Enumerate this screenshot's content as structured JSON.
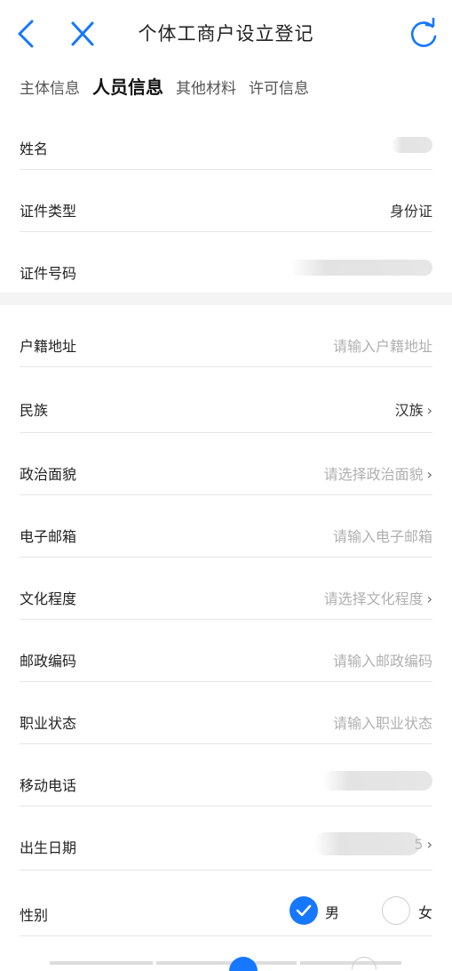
{
  "header": {
    "title": "个体工商户设立登记"
  },
  "tabs": [
    {
      "label": "主体信息"
    },
    {
      "label": "人员信息"
    },
    {
      "label": "其他材料"
    },
    {
      "label": "许可信息"
    }
  ],
  "fields": {
    "name": {
      "label": "姓名"
    },
    "id_type": {
      "label": "证件类型",
      "value": "身份证"
    },
    "id_number": {
      "label": "证件号码"
    },
    "household": {
      "label": "户籍地址",
      "placeholder": "请输入户籍地址"
    },
    "ethnicity": {
      "label": "民族",
      "value": "汉族"
    },
    "political": {
      "label": "政治面貌",
      "placeholder": "请选择政治面貌"
    },
    "email": {
      "label": "电子邮箱",
      "placeholder": "请输入电子邮箱"
    },
    "education": {
      "label": "文化程度",
      "placeholder": "请选择文化程度"
    },
    "postcode": {
      "label": "邮政编码",
      "placeholder": "请输入邮政编码"
    },
    "occupation": {
      "label": "职业状态",
      "placeholder": "请输入职业状态"
    },
    "mobile": {
      "label": "移动电话"
    },
    "birthday": {
      "label": "出生日期",
      "partial": "5"
    },
    "gender": {
      "label": "性别",
      "male": "男",
      "female": "女",
      "selected": "男"
    }
  },
  "chevron": "›",
  "colors": {
    "accent": "#1677ff",
    "placeholder": "#b0b0b0",
    "divider": "#e6e6e6"
  }
}
